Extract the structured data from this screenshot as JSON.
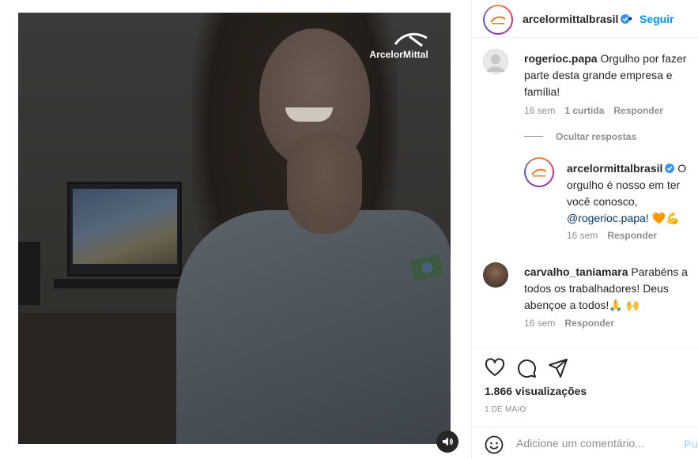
{
  "media": {
    "brand_text": "ArcelorMittal",
    "mute_icon": "speaker-icon"
  },
  "header": {
    "username": "arcelormittalbrasil",
    "dot": "•",
    "follow_label": "Seguir"
  },
  "comments": [
    {
      "user": "rogerioc.papa",
      "text": "Orgulho por fazer parte desta grande empresa e família!",
      "time": "16 sem",
      "likes": "1 curtida",
      "reply": "Responder"
    },
    {
      "hide_replies": "Ocultar respostas"
    },
    {
      "user": "arcelormittalbrasil",
      "text_before": "O orgulho é nosso em ter você conosco,",
      "mention": "@rogerioc.papa!",
      "emoji": "🧡💪",
      "time": "16 sem",
      "reply": "Responder"
    },
    {
      "user": "carvalho_taniamara",
      "text": "Parabéns a todos os trabalhadores! Deus abençoe a todos!🙏 🙌",
      "time": "16 sem",
      "reply": "Responder"
    }
  ],
  "stats": {
    "views": "1.866 visualizações",
    "date": "1 DE MAIO"
  },
  "add_comment": {
    "placeholder": "Adicione um comentário...",
    "publish_label": "Publicar"
  },
  "colors": {
    "link_blue": "#0095f6",
    "mention_blue": "#00376b",
    "muted_grey": "#8e8e8e",
    "brand_orange": "#f47a20"
  }
}
